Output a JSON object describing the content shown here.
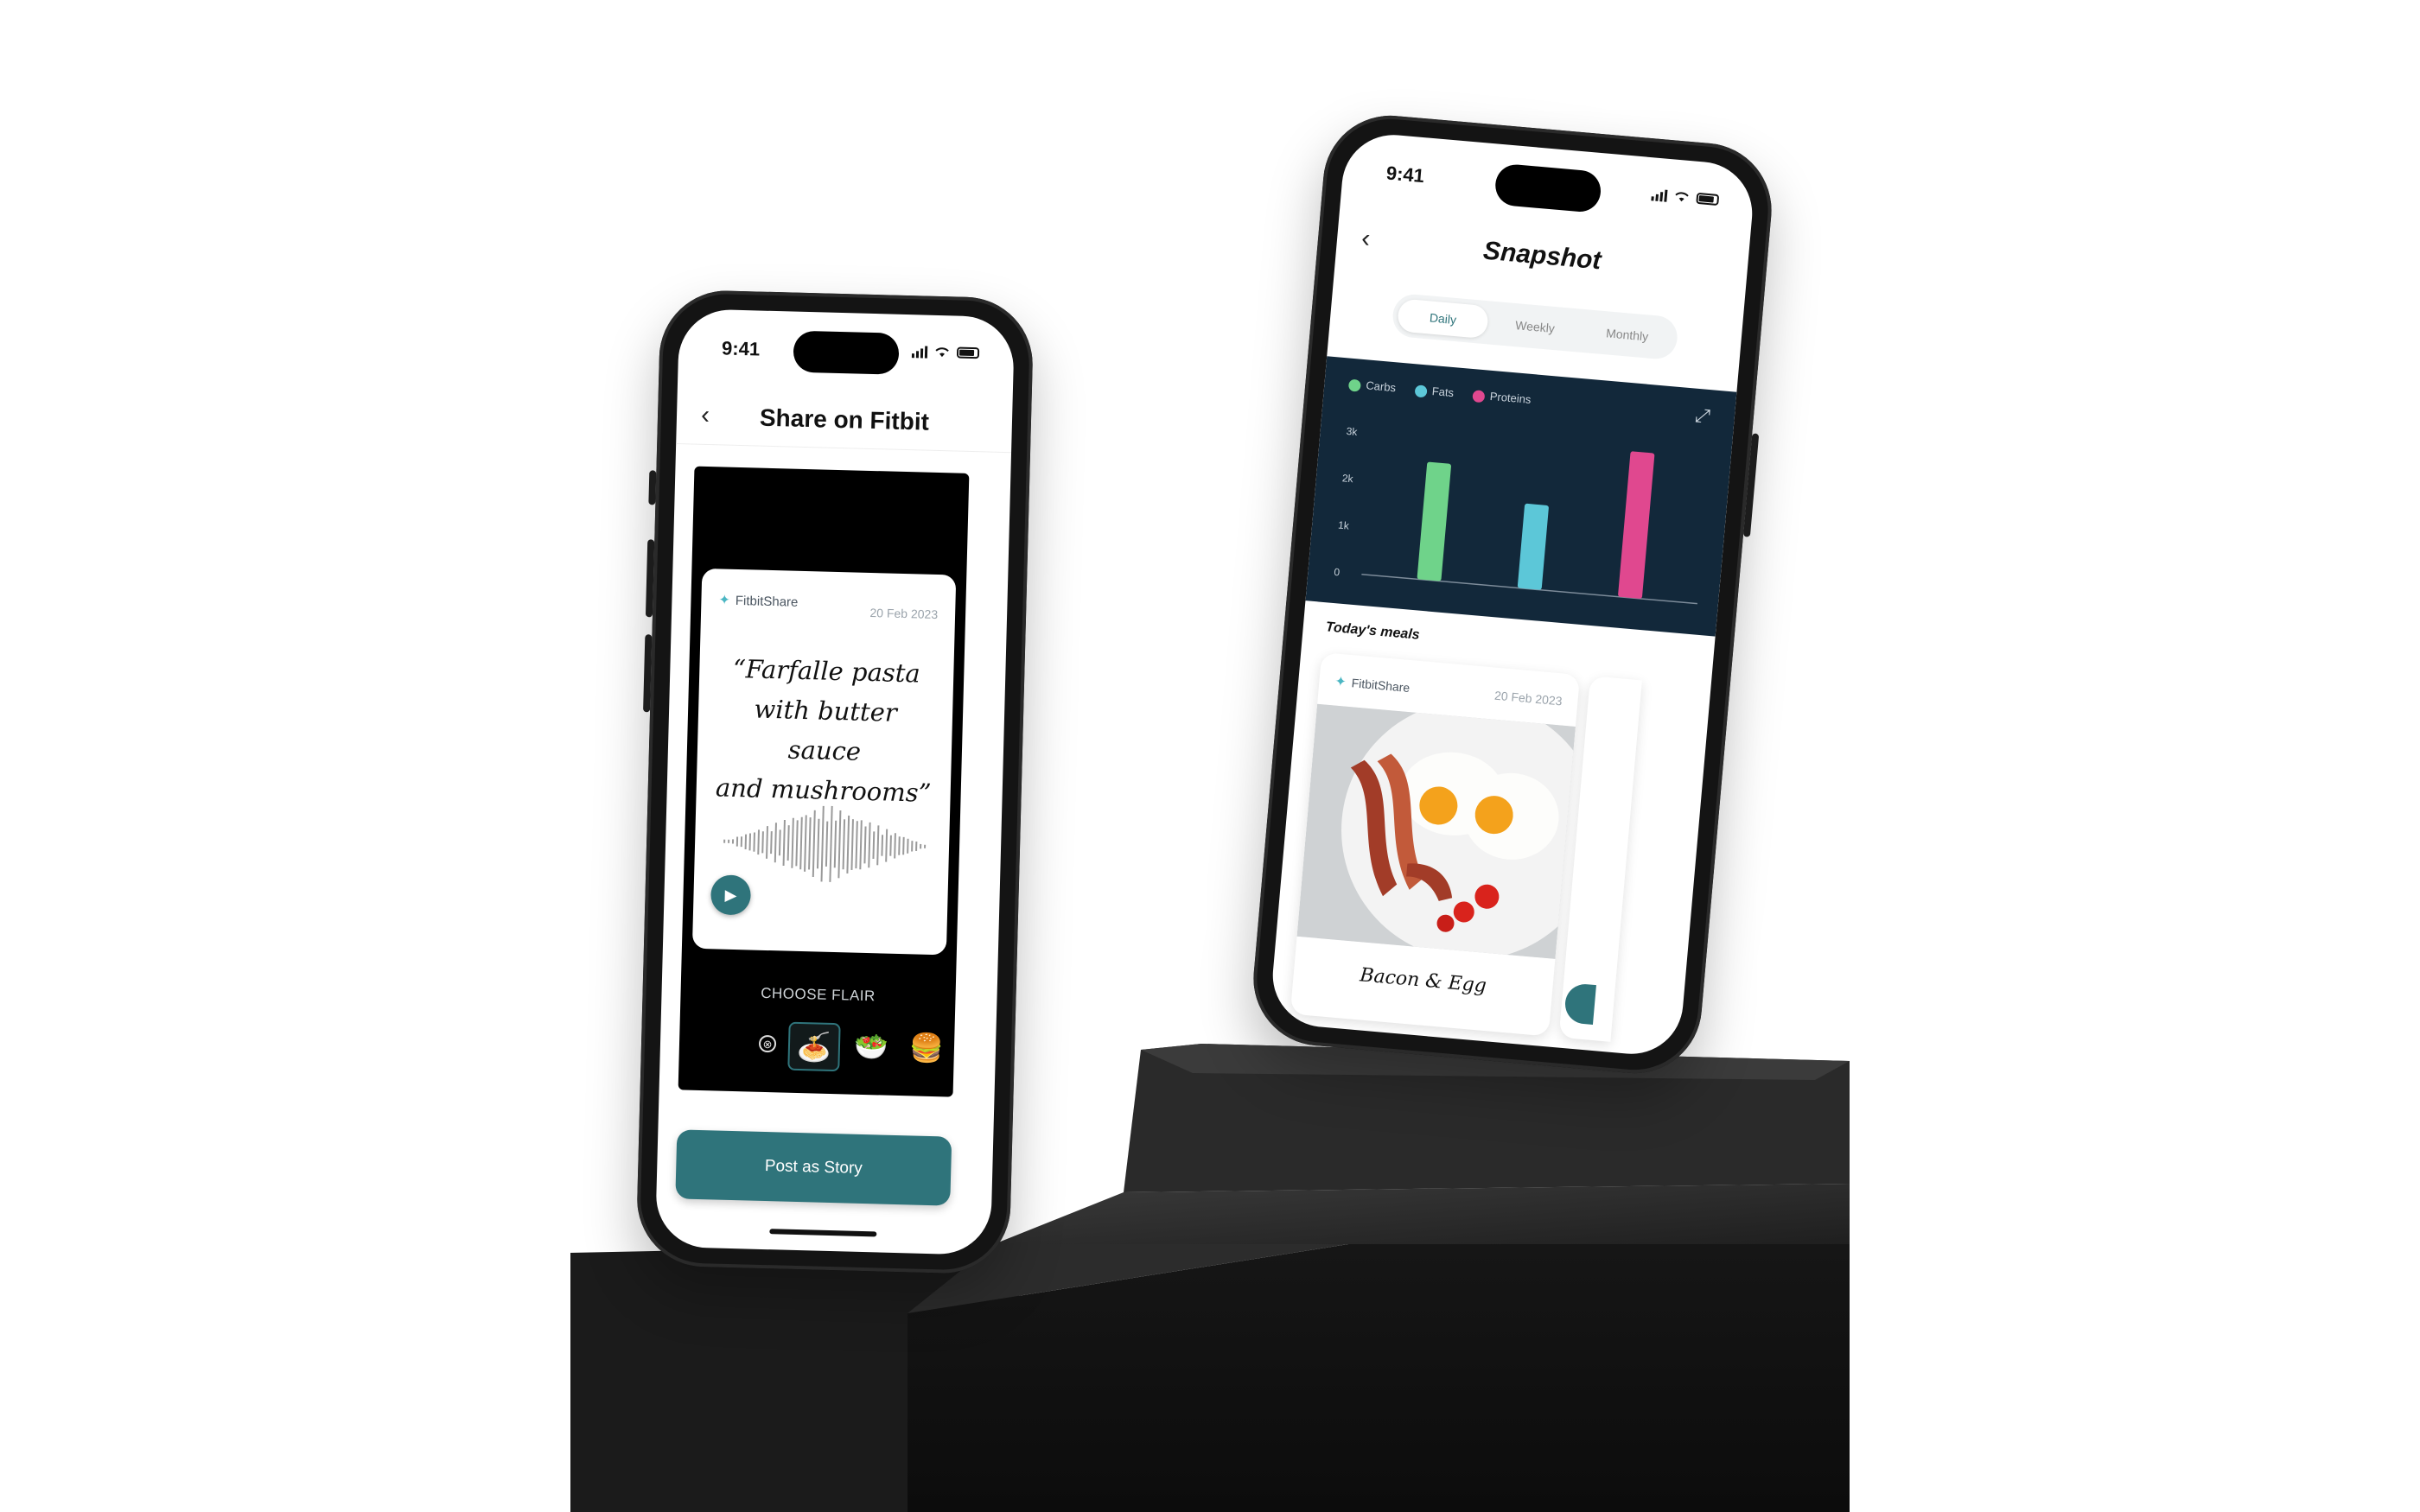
{
  "colors": {
    "teal": "#2f747b",
    "carbs": "#6fd38a",
    "fats": "#5cc7d8",
    "proteins": "#e0488f",
    "chart_bg": "#12283a"
  },
  "share_screen": {
    "status": {
      "time": "9:41"
    },
    "back_icon": "chevron-left-icon",
    "title": "Share on Fitbit",
    "card": {
      "brand": "FitbitShare",
      "date": "20 Feb 2023",
      "quote_lines": [
        "“Farfalle pasta",
        "with butter sauce",
        "and mushrooms”"
      ]
    },
    "choose_flair_label": "CHOOSE FLAIR",
    "flairs": [
      {
        "icon": "none-icon",
        "glyph": "⊗"
      },
      {
        "icon": "spaghetti-icon",
        "glyph": "🍝",
        "selected": true
      },
      {
        "icon": "salad-icon",
        "glyph": "🥗"
      },
      {
        "icon": "burger-icon",
        "glyph": "🍔"
      }
    ],
    "post_button": "Post as Story"
  },
  "snapshot_screen": {
    "status": {
      "time": "9:41"
    },
    "back_icon": "chevron-left-icon",
    "title": "Snapshot",
    "tabs": [
      {
        "label": "Daily",
        "active": true
      },
      {
        "label": "Weekly",
        "active": false
      },
      {
        "label": "Monthly",
        "active": false
      }
    ],
    "meals_title": "Today's meals",
    "meal": {
      "brand": "FitbitShare",
      "date": "20 Feb 2023",
      "name": "Bacon & Egg"
    }
  },
  "chart_data": {
    "type": "bar",
    "categories": [
      "Carbs",
      "Fats",
      "Proteins"
    ],
    "series": [
      {
        "name": "Carbs",
        "values": [
          2500
        ]
      },
      {
        "name": "Fats",
        "values": [
          1800
        ]
      },
      {
        "name": "Proteins",
        "values": [
          3100
        ]
      }
    ],
    "values": [
      2500,
      1800,
      3100
    ],
    "ytick_labels": [
      "0",
      "1k",
      "2k",
      "3k"
    ],
    "yticks": [
      0,
      1000,
      2000,
      3000
    ],
    "ylim": [
      0,
      3300
    ],
    "legend_position": "top-left",
    "grid": false
  }
}
